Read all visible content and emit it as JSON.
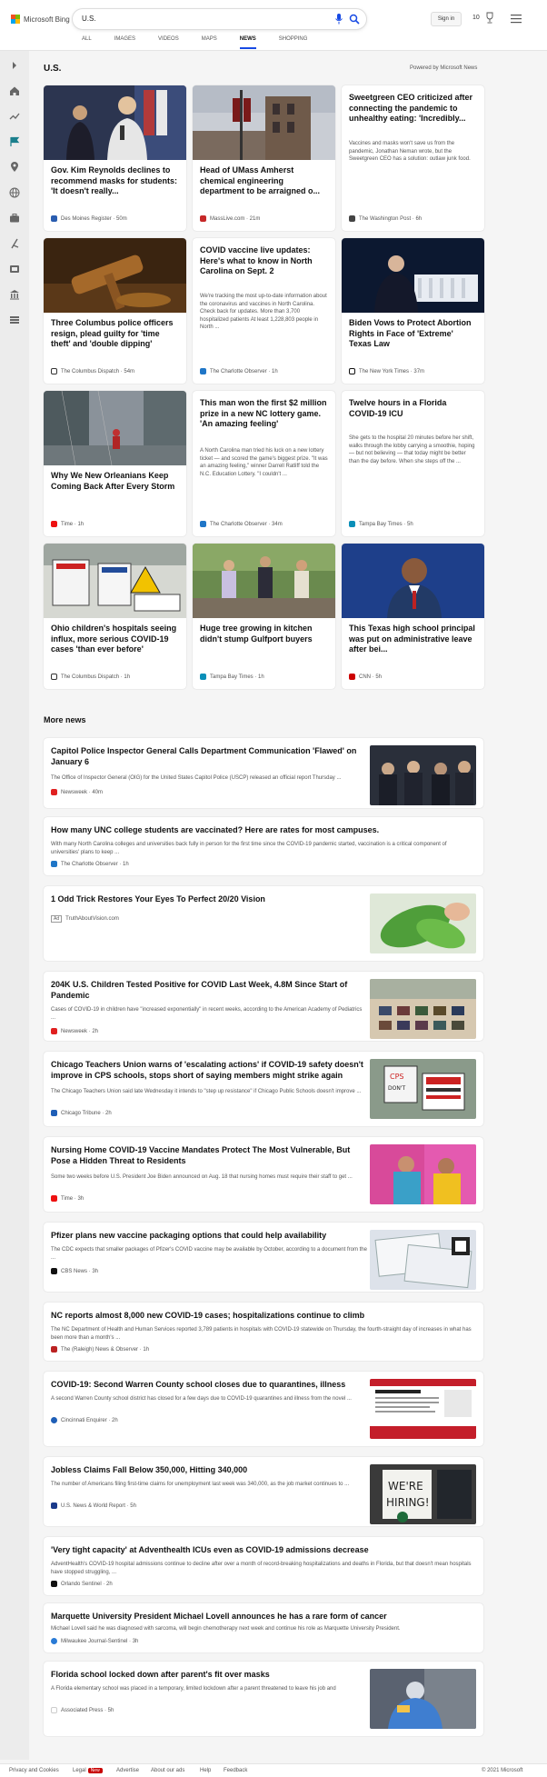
{
  "header": {
    "logo_text": "Microsoft Bing",
    "search_value": "U.S.",
    "signin_label": "Sign in",
    "points": "10",
    "tabs": [
      "ALL",
      "IMAGES",
      "VIDEOS",
      "MAPS",
      "NEWS",
      "SHOPPING"
    ],
    "active_tab": "NEWS"
  },
  "main": {
    "title": "U.S.",
    "powered_by": "Powered by Microsoft News",
    "cards": [
      {
        "title": "Gov. Kim Reynolds declines to recommend masks for students: 'It doesn't really...",
        "snippet": "",
        "source": "Des Moines Register · 50m",
        "image": "photo-reynolds"
      },
      {
        "title": "Head of UMass Amherst chemical engineering department to be arraigned o...",
        "snippet": "",
        "source": "MassLive.com · 21m",
        "image": "photo-umass"
      },
      {
        "title": "Sweetgreen CEO criticized after connecting the pandemic to unhealthy eating: 'Incredibly...",
        "snippet": "Vaccines and masks won't save us from the pandemic, Jonathan Neman wrote, but the Sweetgreen CEO has a solution: outlaw junk food.",
        "source": "The Washington Post · 6h",
        "image": ""
      },
      {
        "title": "Three Columbus police officers resign, plead guilty for 'time theft' and 'double dipping'",
        "snippet": "",
        "source": "The Columbus Dispatch · 54m",
        "image": "photo-gavel"
      },
      {
        "title": "COVID vaccine live updates: Here's what to know in North Carolina on Sept. 2",
        "snippet": "We're tracking the most up-to-date information about the coronavirus and vaccines in North Carolina. Check back for updates. More than 3,700 hospitalized patients At least 1,228,803 people in North ...",
        "source": "The Charlotte Observer · 1h",
        "image": ""
      },
      {
        "title": "Biden Vows to Protect Abortion Rights in Face of 'Extreme' Texas Law",
        "snippet": "",
        "source": "The New York Times · 37m",
        "image": "photo-biden"
      },
      {
        "title": "Why We New Orleanians Keep Coming Back After Every Storm",
        "snippet": "",
        "source": "Time · 1h",
        "image": "photo-storm"
      },
      {
        "title": "This man won the first $2 million prize in a new NC lottery game. 'An amazing feeling'",
        "snippet": "A North Carolina man tried his luck on a new lottery ticket — and scored the game's biggest prize. \"It was an amazing feeling,\" winner Darrell Ratliff told the N.C. Education Lottery. \"I couldn't ...",
        "source": "The Charlotte Observer · 34m",
        "image": ""
      },
      {
        "title": "Twelve hours in a Florida COVID-19 ICU",
        "snippet": "She gets to the hospital 20 minutes before her shift, walks through the lobby carrying a smoothie, hoping — but not believing — that today might be better than the day before. When she steps off the ...",
        "source": "Tampa Bay Times · 5h",
        "image": ""
      },
      {
        "title": "Ohio children's hospitals seeing influx, more serious COVID-19 cases 'than ever before'",
        "snippet": "",
        "source": "The Columbus Dispatch · 1h",
        "image": "photo-hospital"
      },
      {
        "title": "Huge tree growing in kitchen didn't stump Gulfport buyers",
        "snippet": "",
        "source": "Tampa Bay Times · 1h",
        "image": "photo-tree"
      },
      {
        "title": "This Texas high school principal was put on administrative leave after bei...",
        "snippet": "",
        "source": "CNN · 5h",
        "image": "photo-principal"
      }
    ],
    "more_news_title": "More news",
    "more_news": [
      {
        "title": "Capitol Police Inspector General Calls Department Communication 'Flawed' on January 6",
        "snippet": "The Office of Inspector General (OIG) for the United States Capitol Police (USCP) released an official report Thursday ...",
        "source": "Newsweek · 40m"
      },
      {
        "title": "How many UNC college students are vaccinated? Here are rates for most campuses.",
        "snippet": "With many North Carolina colleges and universities back fully in person for the first time since the COVID-19 pandemic started, vaccination is a critical component of universities' plans to keep ...",
        "source": "The Charlotte Observer · 1h"
      },
      {
        "title": "1 Odd Trick Restores Your Eyes To Perfect 20/20 Vision",
        "snippet": "",
        "source": "TruthAboutVision.com",
        "ad_label": "Ad"
      },
      {
        "title": "204K U.S. Children Tested Positive for COVID Last Week, 4.8M Since Start of Pandemic",
        "snippet": "Cases of COVID-19 in children have \"increased exponentially\" in recent weeks, according to the American Academy of Pediatrics ...",
        "source": "Newsweek · 2h"
      },
      {
        "title": "Chicago Teachers Union warns of 'escalating actions' if COVID-19 safety doesn't improve in CPS schools, stops short of saying members might strike again",
        "snippet": "The Chicago Teachers Union said late Wednesday it intends to \"step up resistance\" if Chicago Public Schools doesn't improve ...",
        "source": "Chicago Tribune · 2h"
      },
      {
        "title": "Nursing Home COVID-19 Vaccine Mandates Protect The Most Vulnerable, But Pose a Hidden Threat to Residents",
        "snippet": "Some two weeks before U.S. President Joe Biden announced on Aug. 18 that nursing homes must require their staff to get ...",
        "source": "Time · 3h"
      },
      {
        "title": "Pfizer plans new vaccine packaging options that could help availability",
        "snippet": "The CDC expects that smaller packages of Pfizer's COVID vaccine may be available by October, according to a document from the ...",
        "source": "CBS News · 3h"
      },
      {
        "title": "NC reports almost 8,000 new COVID-19 cases; hospitalizations continue to climb",
        "snippet": "The NC Department of Health and Human Services reported 3,789 patients in hospitals with COVID-19 statewide on Thursday, the fourth-straight day of increases in what has been more than a month's ...",
        "source": "The (Raleigh) News & Observer · 1h"
      },
      {
        "title": "COVID-19: Second Warren County school closes due to quarantines, illness",
        "snippet": "A second Warren County school district has closed for a few days due to COVID-19 quarantines and illness from the novel ...",
        "source": "Cincinnati Enquirer · 2h"
      },
      {
        "title": "Jobless Claims Fall Below 350,000, Hitting 340,000",
        "snippet": "The number of Americans filing first-time claims for unemployment last week was 340,000, as the job market continues to ...",
        "source": "U.S. News & World Report · 5h"
      },
      {
        "title": "'Very tight capacity' at Adventhealth ICUs even as COVID-19 admissions decrease",
        "snippet": "AdventHealth's COVID-19 hospital admissions continue to decline after over a month of record-breaking hospitalizations and deaths in Florida, but that doesn't mean hospitals have stopped struggling, ...",
        "source": "Orlando Sentinel · 2h"
      },
      {
        "title": "Marquette University President Michael Lovell announces he has a rare form of cancer",
        "snippet": "Michael Lovell said he was diagnosed with sarcoma, will begin chemotherapy next week and continue his role as Marquette University President.",
        "source": "Milwaukee Journal-Sentinel · 3h"
      },
      {
        "title": "Florida school locked down after parent's fit over masks",
        "snippet": "A Florida elementary school was placed in a temporary, limited lockdown after a parent threatened to leave his job and",
        "source": "Associated Press · 5h"
      }
    ]
  },
  "footer": {
    "privacy": "Privacy and Cookies",
    "legal": "Legal",
    "new_badge": "New",
    "advertise": "Advertise",
    "about_ads": "About our ads",
    "help": "Help",
    "feedback": "Feedback",
    "copyright": "© 2021 Microsoft"
  },
  "colors": {
    "accent": "#174ae4",
    "page_bg": "#f5f5f5",
    "sidebar_bg": "#ececec"
  }
}
